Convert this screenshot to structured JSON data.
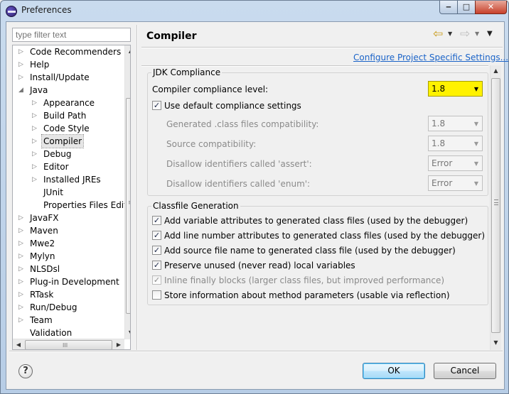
{
  "window": {
    "title": "Preferences",
    "minimize_glyph": "‒",
    "maximize_glyph": "□",
    "close_glyph": "✕"
  },
  "filter": {
    "placeholder": "type filter text"
  },
  "tree": {
    "items": [
      {
        "label": "Code Recommenders",
        "expander": "▷"
      },
      {
        "label": "Help",
        "expander": "▷"
      },
      {
        "label": "Install/Update",
        "expander": "▷"
      },
      {
        "label": "Java",
        "expander": "◢"
      },
      {
        "label": "Appearance",
        "expander": "▷"
      },
      {
        "label": "Build Path",
        "expander": "▷"
      },
      {
        "label": "Code Style",
        "expander": "▷"
      },
      {
        "label": "Compiler",
        "expander": "▷",
        "selected": true
      },
      {
        "label": "Debug",
        "expander": "▷"
      },
      {
        "label": "Editor",
        "expander": "▷"
      },
      {
        "label": "Installed JREs",
        "expander": "▷"
      },
      {
        "label": "JUnit",
        "expander": ""
      },
      {
        "label": "Properties Files Edito",
        "expander": ""
      },
      {
        "label": "JavaFX",
        "expander": "▷"
      },
      {
        "label": "Maven",
        "expander": "▷"
      },
      {
        "label": "Mwe2",
        "expander": "▷"
      },
      {
        "label": "Mylyn",
        "expander": "▷"
      },
      {
        "label": "NLSDsl",
        "expander": "▷"
      },
      {
        "label": "Plug-in Development",
        "expander": "▷"
      },
      {
        "label": "RTask",
        "expander": "▷"
      },
      {
        "label": "Run/Debug",
        "expander": "▷"
      },
      {
        "label": "Team",
        "expander": "▷"
      },
      {
        "label": "Validation",
        "expander": ""
      }
    ],
    "scroll_up": "▲",
    "scroll_down": "▼",
    "scroll_left": "◀",
    "scroll_right": "▶",
    "hgrip": "III",
    "vgrip": "≡"
  },
  "page": {
    "title": "Compiler",
    "back_icon": "⇦",
    "forward_icon": "⇨",
    "menu_arrow": "▼",
    "config_link": "Configure Project Specific Settings...",
    "scroll_up": "▲",
    "scroll_down": "▼"
  },
  "jdk": {
    "group_label": "JDK Compliance",
    "compliance_label": "Compiler compliance level:",
    "compliance_value": "1.8",
    "use_default_label": "Use default compliance settings",
    "use_default_checked": true,
    "generated_label": "Generated .class files compatibility:",
    "generated_value": "1.8",
    "source_label": "Source compatibility:",
    "source_value": "1.8",
    "assert_label": "Disallow identifiers called 'assert':",
    "assert_value": "Error",
    "enum_label": "Disallow identifiers called 'enum':",
    "enum_value": "Error",
    "highlight_color": "#fff200"
  },
  "classfile": {
    "group_label": "Classfile Generation",
    "options": [
      {
        "label": "Add variable attributes to generated class files (used by the debugger)",
        "checked": true,
        "enabled": true
      },
      {
        "label": "Add line number attributes to generated class files (used by the debugger)",
        "checked": true,
        "enabled": true
      },
      {
        "label": "Add source file name to generated class file (used by the debugger)",
        "checked": true,
        "enabled": true
      },
      {
        "label": "Preserve unused (never read) local variables",
        "checked": true,
        "enabled": true
      },
      {
        "label": "Inline finally blocks (larger class files, but improved performance)",
        "checked": true,
        "enabled": false
      },
      {
        "label": "Store information about method parameters (usable via reflection)",
        "checked": false,
        "enabled": true
      }
    ]
  },
  "buttons": {
    "help": "?",
    "ok": "OK",
    "cancel": "Cancel"
  },
  "check_glyph": "✓"
}
